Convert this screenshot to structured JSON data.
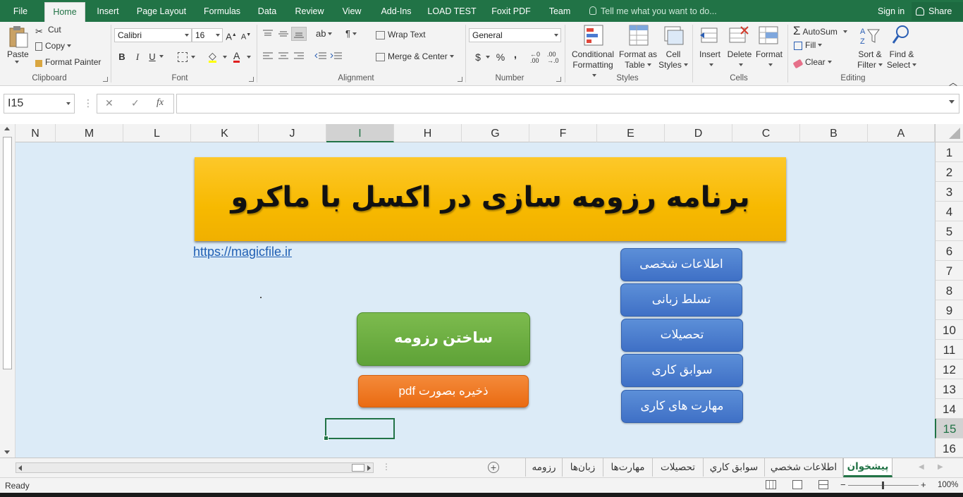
{
  "menu_tabs": [
    "File",
    "Home",
    "Insert",
    "Page Layout",
    "Formulas",
    "Data",
    "Review",
    "View",
    "Add-Ins",
    "LOAD TEST",
    "Foxit PDF",
    "Team"
  ],
  "tell_me": "Tell me what you want to do...",
  "sign_in": "Sign in",
  "share": "Share",
  "clipboard": {
    "paste": "Paste",
    "cut": "Cut",
    "copy": "Copy",
    "format_painter": "Format Painter",
    "label": "Clipboard"
  },
  "font": {
    "name": "Calibri",
    "size": "16",
    "bold": "B",
    "italic": "I",
    "underline": "U",
    "label": "Font"
  },
  "alignment": {
    "wrap_text": "Wrap Text",
    "merge_center": "Merge & Center",
    "label": "Alignment"
  },
  "number": {
    "format": "General",
    "currency": "$",
    "percent": "%",
    "comma": ",",
    "label": "Number"
  },
  "styles": {
    "conditional": "Conditional",
    "conditional2": "Formatting",
    "format_as": "Format as",
    "format_as2": "Table",
    "cell": "Cell",
    "cell2": "Styles",
    "label": "Styles"
  },
  "cells": {
    "insert": "Insert",
    "delete": "Delete",
    "format": "Format",
    "label": "Cells"
  },
  "editing": {
    "autosum": "AutoSum",
    "fill": "Fill",
    "clear": "Clear",
    "sort": "Sort &",
    "sort2": "Filter",
    "find": "Find &",
    "find2": "Select",
    "label": "Editing"
  },
  "name_box": "I15",
  "fx": "fx",
  "columns": [
    "N",
    "M",
    "L",
    "K",
    "J",
    "I",
    "H",
    "G",
    "F",
    "E",
    "D",
    "C",
    "B",
    "A"
  ],
  "rows": [
    "1",
    "2",
    "3",
    "4",
    "5",
    "6",
    "7",
    "8",
    "9",
    "10",
    "11",
    "12",
    "13",
    "14",
    "15",
    "16"
  ],
  "sheet_content": {
    "banner": "برنامه رزومه سازی در اکسل با ماکرو",
    "link": "https://magicfile.ir",
    "nav_buttons": [
      "اطلاعات شخصی",
      "تسلط زبانی",
      "تحصیلات",
      "سوابق کاری",
      "مهارت های کاری"
    ],
    "build_button": "ساختن رزومه",
    "pdf_button": "ذخیره بصورت pdf"
  },
  "sheet_tabs": [
    "پیشخوان",
    "اطلاعات شخصي",
    "سوابق كاري",
    "تحصیلات",
    "مهارت‌ها",
    "زبان‌ها",
    "رزومه"
  ],
  "status": {
    "ready": "Ready",
    "zoom": "100%"
  }
}
